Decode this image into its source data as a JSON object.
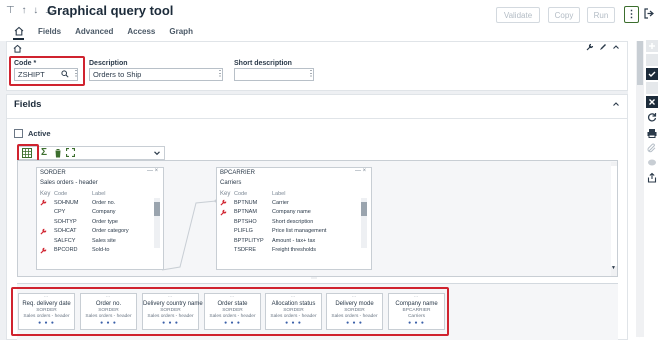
{
  "header": {
    "nav_arrows": "⊤ ↑ ↓ ⊥",
    "title": "Graphical query tool",
    "buttons": {
      "validate": "Validate",
      "copy": "Copy",
      "run": "Run"
    },
    "more": "⋮"
  },
  "tabs": [
    "Fields",
    "Advanced",
    "Access",
    "Graph"
  ],
  "form": {
    "code_label": "Code *",
    "code_value": "ZSHIPT",
    "description_label": "Description",
    "description_value": "Orders to Ship",
    "short_description_label": "Short description",
    "short_description_value": ""
  },
  "fields_section": {
    "title": "Fields",
    "active_label": "Active"
  },
  "tables": [
    {
      "name": "SORDER",
      "desc": "Sales orders - header",
      "head": {
        "key": "Key",
        "code": "Code",
        "label": "Label"
      },
      "rows": [
        {
          "key": true,
          "code": "SOHNUM",
          "label": "Order no."
        },
        {
          "key": false,
          "code": "CPY",
          "label": "Company"
        },
        {
          "key": false,
          "code": "SOHTYP",
          "label": "Order type"
        },
        {
          "key": true,
          "code": "SOHCAT",
          "label": "Order category"
        },
        {
          "key": false,
          "code": "SALFCY",
          "label": "Sales site"
        },
        {
          "key": true,
          "code": "BPCORD",
          "label": "Sold-to"
        }
      ]
    },
    {
      "name": "BPCARRIER",
      "desc": "Carriers",
      "head": {
        "key": "Key",
        "code": "Code",
        "label": "Label"
      },
      "rows": [
        {
          "key": true,
          "code": "BPTNUM",
          "label": "Carrier"
        },
        {
          "key": true,
          "code": "BPTNAM",
          "label": "Company name"
        },
        {
          "key": false,
          "code": "BPTSHO",
          "label": "Short description"
        },
        {
          "key": false,
          "code": "PLIFLG",
          "label": "Price list management"
        },
        {
          "key": false,
          "code": "BPTPLITYP",
          "label": "Amount - tax+ tax"
        },
        {
          "key": false,
          "code": "TSDFRE",
          "label": "Freight thresholds"
        }
      ]
    }
  ],
  "field_cards": [
    {
      "name": "Req. delivery date",
      "table": "SORDER",
      "sub": "Sales orders - header"
    },
    {
      "name": "Order no.",
      "table": "SORDER",
      "sub": "Sales orders - header"
    },
    {
      "name": "Delivery country name",
      "table": "SORDER",
      "sub": "Sales orders - header"
    },
    {
      "name": "Order state",
      "table": "SORDER",
      "sub": "Sales orders - header"
    },
    {
      "name": "Allocation status",
      "table": "SORDER",
      "sub": "Sales orders - header"
    },
    {
      "name": "Delivery mode",
      "table": "SORDER",
      "sub": "Sales orders - header"
    },
    {
      "name": "Company name",
      "table": "BPCARRIER",
      "sub": "Carriers"
    }
  ],
  "card_handle": "⋯",
  "card_dots": "● ● ●",
  "colors": {
    "highlight": "#d0232f",
    "accent": "#3c6e2e",
    "link": "#3a5fa8"
  }
}
